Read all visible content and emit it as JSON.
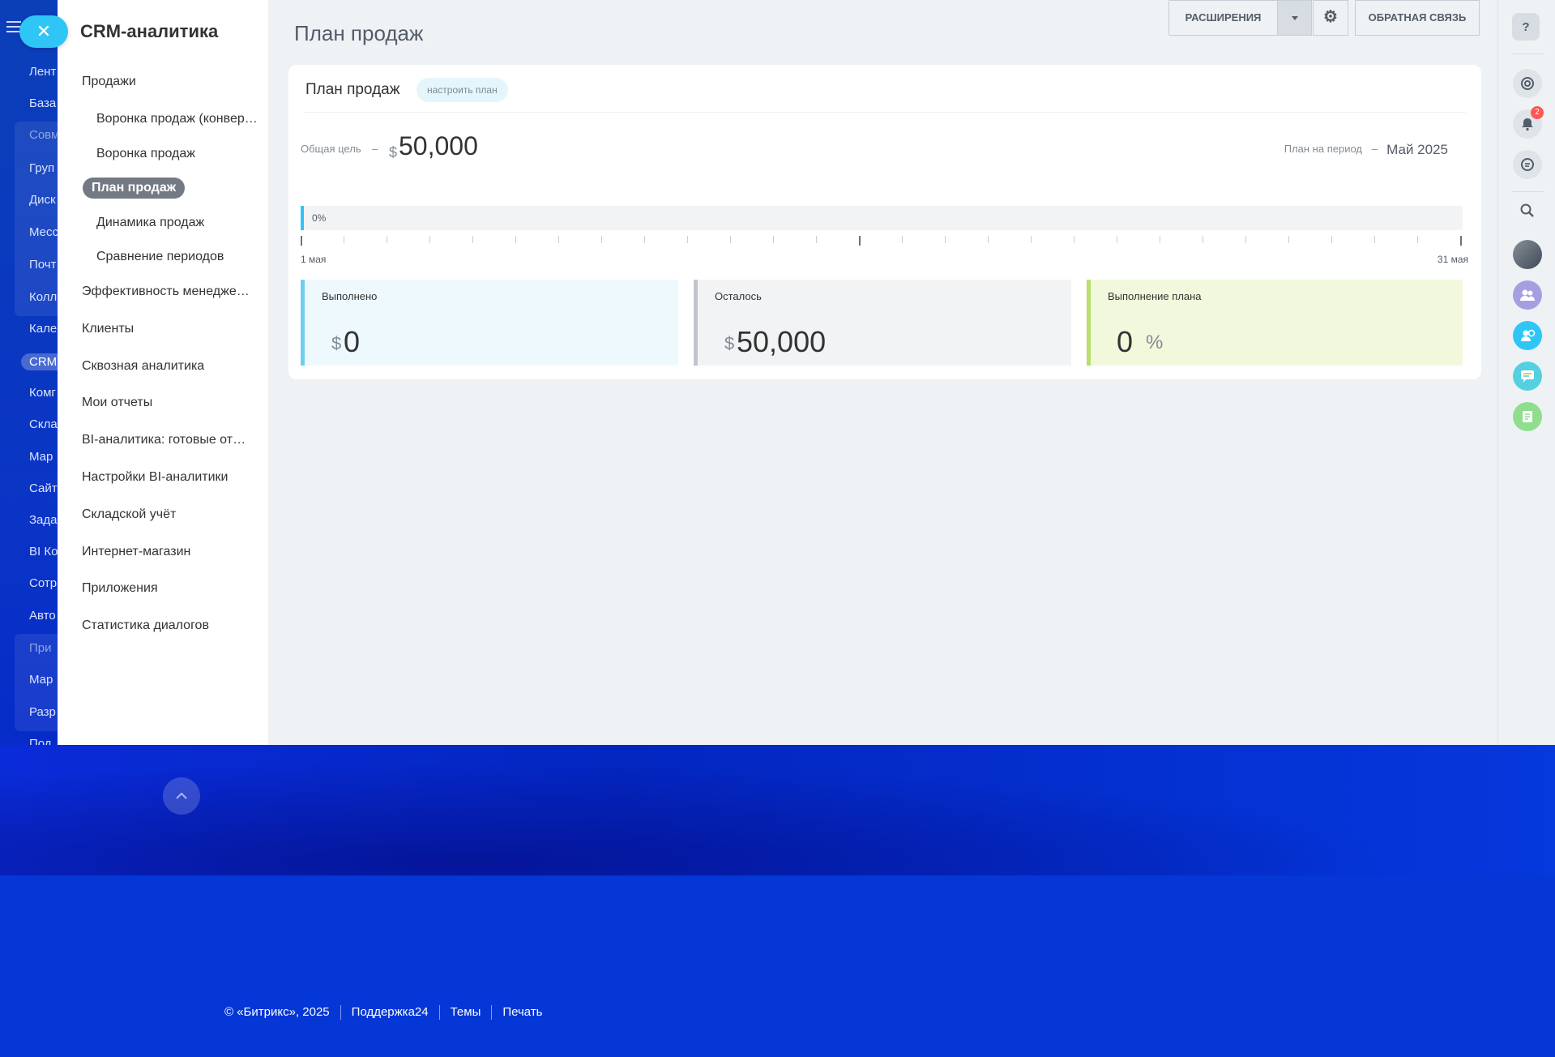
{
  "background_menu": {
    "items": [
      {
        "label": "Лент",
        "dim": false
      },
      {
        "label": "База",
        "dim": false
      },
      {
        "label": "Совм",
        "dim": true
      },
      {
        "label": "Груп",
        "dim": false
      },
      {
        "label": "Диск",
        "dim": false
      },
      {
        "label": "Месс",
        "dim": false
      },
      {
        "label": "Почт",
        "dim": false
      },
      {
        "label": "Колл",
        "dim": false
      },
      {
        "label": "Кале",
        "dim": false
      },
      {
        "label": "CRM",
        "dim": false
      },
      {
        "label": "Комг",
        "dim": false
      },
      {
        "label": "Скла",
        "dim": false
      },
      {
        "label": "Мар",
        "dim": false
      },
      {
        "label": "Сайт",
        "dim": false
      },
      {
        "label": "Зада",
        "dim": false
      },
      {
        "label": "BI Ко",
        "dim": false
      },
      {
        "label": "Сотр",
        "dim": false
      },
      {
        "label": "Авто",
        "dim": false
      },
      {
        "label": "При",
        "dim": true
      },
      {
        "label": "Мар",
        "dim": false
      },
      {
        "label": "Разр",
        "dim": false
      },
      {
        "label": "Под",
        "dim": false
      }
    ],
    "close_glyph": "✕"
  },
  "sidebar": {
    "title": "CRM-аналитика",
    "items": [
      {
        "label": "Продажи"
      },
      {
        "label": "Воронка продаж (конверсия)"
      },
      {
        "label": "Воронка продаж"
      },
      {
        "label": "План продаж"
      },
      {
        "label": "Динамика продаж"
      },
      {
        "label": "Сравнение периодов"
      },
      {
        "label": "Эффективность менеджеров"
      },
      {
        "label": "Клиенты"
      },
      {
        "label": "Сквозная аналитика"
      },
      {
        "label": "Мои отчеты"
      },
      {
        "label": "BI-аналитика: готовые отчеты"
      },
      {
        "label": "Настройки BI-аналитики"
      },
      {
        "label": "Складской учёт"
      },
      {
        "label": "Интернет-магазин"
      },
      {
        "label": "Приложения"
      },
      {
        "label": "Статистика диалогов"
      }
    ]
  },
  "header": {
    "title": "План продаж",
    "extensions_label": "РАСШИРЕНИЯ",
    "feedback_label": "ОБРАТНАЯ СВЯЗЬ",
    "gear_glyph": "⚙"
  },
  "plan_card": {
    "title": "План продаж",
    "configure_label": "настроить план",
    "goal_label": "Общая цель",
    "dash": "–",
    "currency": "$",
    "goal_value": "50,000",
    "period_label": "План на период",
    "period_value": "Май 2025",
    "progress_percent": 0,
    "progress_label": "0%",
    "day_start": "1 мая",
    "day_end": "31 мая"
  },
  "stats": {
    "done": {
      "label": "Выполнено",
      "currency": "$",
      "value": "0"
    },
    "left": {
      "label": "Осталось",
      "currency": "$",
      "value": "50,000"
    },
    "plan": {
      "label": "Выполнение плана",
      "value": "0",
      "unit": "%"
    }
  },
  "rightbar": {
    "help_glyph": "?",
    "notification_count": "2"
  },
  "footer": {
    "copyright": "© «Битрикс», 2025",
    "support": "Поддержка24",
    "themes": "Темы",
    "print": "Печать"
  },
  "colors": {
    "accent": "#2fc6f6",
    "done_bar": "#6ecff1",
    "left_bar": "#c0c6cc",
    "plan_bar": "#b7df6a",
    "page_bg": "#0437d6"
  }
}
